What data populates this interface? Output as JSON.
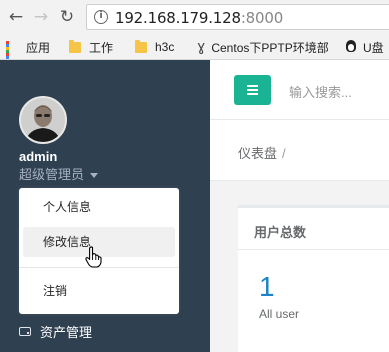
{
  "browser": {
    "url_host": "192.168.179.128",
    "url_port": ":8000",
    "bookmarks": [
      {
        "label": "应用",
        "icon": "apps-icon"
      },
      {
        "label": "工作",
        "icon": "folder-icon"
      },
      {
        "label": "h3c",
        "icon": "folder-icon"
      },
      {
        "label": "Centos下PPTP环境部",
        "icon": "v-logo-icon"
      },
      {
        "label": "U盘",
        "icon": "tux-icon"
      }
    ]
  },
  "sidebar": {
    "username": "admin",
    "role": "超级管理员",
    "menu_assets": "资产管理"
  },
  "dropdown": {
    "items": [
      "个人信息",
      "修改信息",
      "注销"
    ],
    "active_index": 1
  },
  "header": {
    "search_placeholder": "输入搜索..."
  },
  "breadcrumb": {
    "current": "仪表盘",
    "separator": "/"
  },
  "card": {
    "title": "用户总数",
    "value": "1",
    "subtitle": "All user"
  },
  "colors": {
    "sidebar_bg": "#2f4050",
    "accent_green": "#1ab394",
    "value_blue": "#1c84c6"
  }
}
